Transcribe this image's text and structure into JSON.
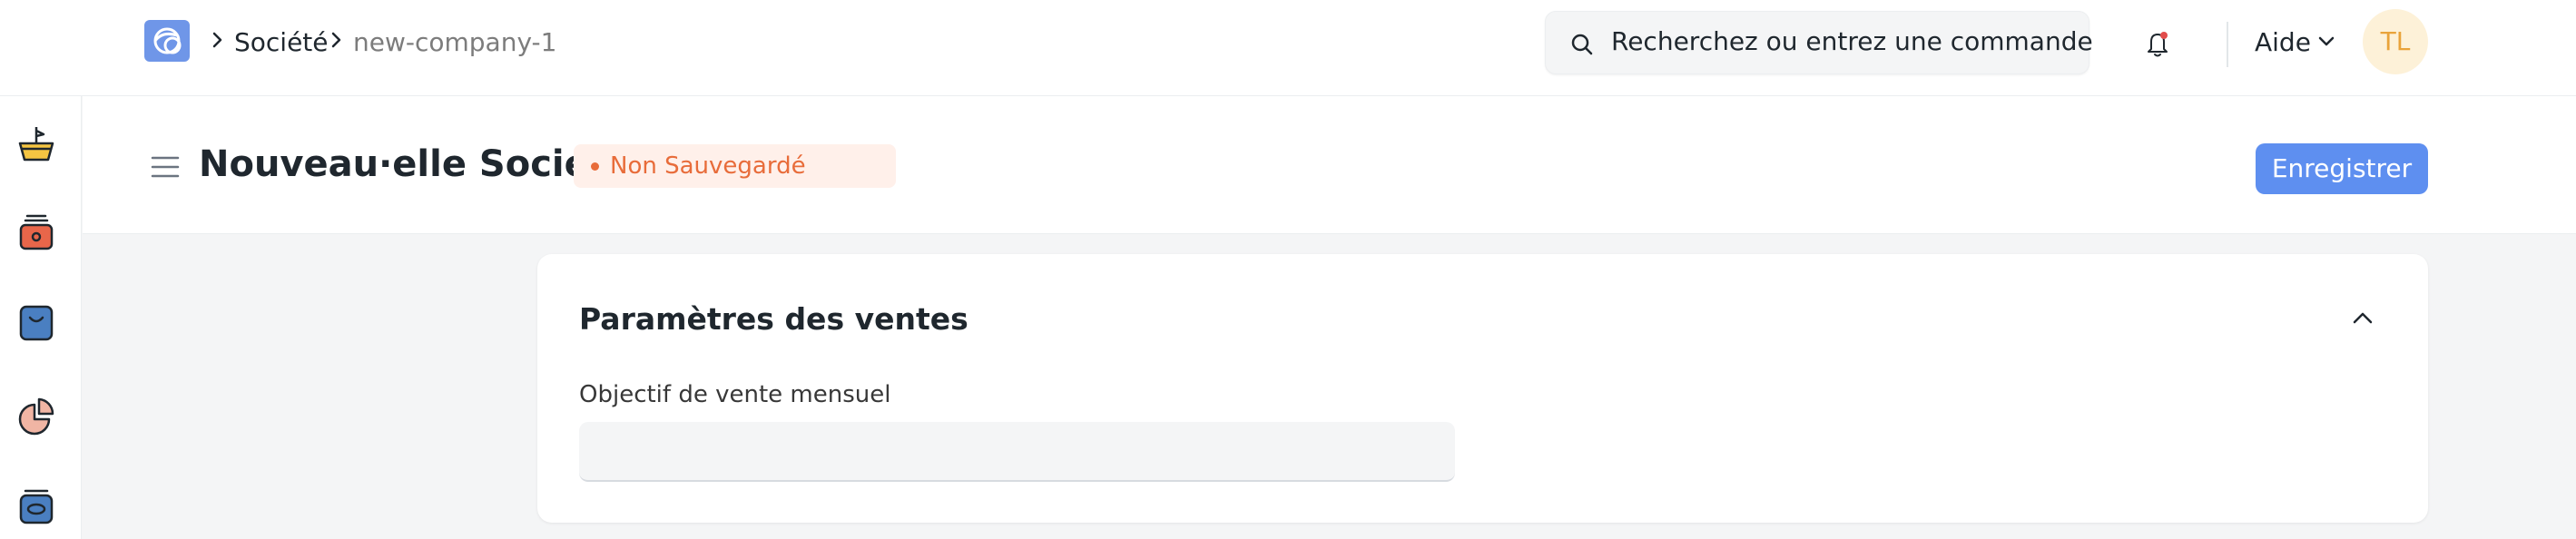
{
  "breadcrumb": {
    "items": [
      "Société",
      "new-company-1"
    ]
  },
  "search": {
    "placeholder": "Recherchez ou entrez une commande"
  },
  "navbar": {
    "help_label": "Aide",
    "avatar_initials": "TL"
  },
  "page": {
    "title": "Nouveau·elle Société",
    "status": "Non Sauvegardé",
    "save_label": "Enregistrer"
  },
  "section": {
    "title": "Paramètres des ventes",
    "fields": [
      {
        "label": "Objectif de vente mensuel",
        "value": ""
      }
    ]
  },
  "sidebar": {
    "icons": [
      "plant-pot-icon",
      "cash-register-icon",
      "shopping-bag-icon",
      "pie-chart-icon",
      "box-icon"
    ]
  },
  "colors": {
    "primary": "#5e8ff0",
    "status": "#e86c3a",
    "status_bg": "#fff0ea",
    "avatar_bg": "#fdf1d8",
    "avatar_text": "#e9a33a",
    "page_bg": "#f4f5f6"
  }
}
